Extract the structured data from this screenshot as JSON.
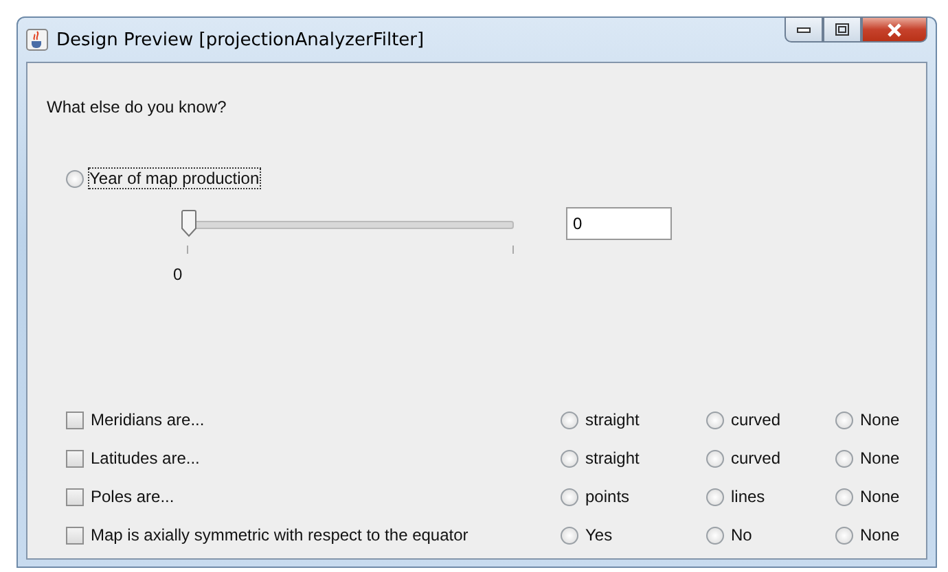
{
  "window": {
    "title": "Design Preview [projectionAnalyzerFilter]"
  },
  "question": "What else do you know?",
  "year": {
    "label": "Year of map production",
    "selected": false,
    "focused": true,
    "slider": {
      "level": 0,
      "tick_label": "0"
    },
    "field": {
      "value": "0"
    }
  },
  "properties": [
    {
      "label": "Meridians are...",
      "checked": false,
      "options": [
        {
          "label": "straight",
          "selected": false
        },
        {
          "label": "curved",
          "selected": false
        },
        {
          "label": "None",
          "selected": false
        }
      ]
    },
    {
      "label": "Latitudes are...",
      "checked": false,
      "options": [
        {
          "label": "straight",
          "selected": false
        },
        {
          "label": "curved",
          "selected": false
        },
        {
          "label": "None",
          "selected": false
        }
      ]
    },
    {
      "label": "Poles are...",
      "checked": false,
      "options": [
        {
          "label": "points",
          "selected": false
        },
        {
          "label": "lines",
          "selected": false
        },
        {
          "label": "None",
          "selected": false
        }
      ]
    },
    {
      "label": "Map is axially symmetric with respect to the equator",
      "checked": false,
      "options": [
        {
          "label": "Yes",
          "selected": false
        },
        {
          "label": "No",
          "selected": false
        },
        {
          "label": "None",
          "selected": false
        }
      ]
    }
  ]
}
